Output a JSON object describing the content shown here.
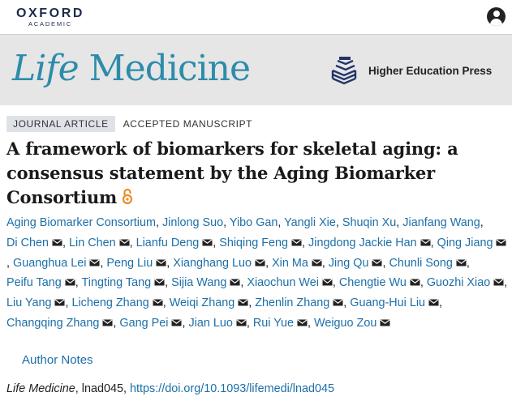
{
  "header": {
    "brand_main": "OXFORD",
    "brand_sub": "ACADEMIC"
  },
  "banner": {
    "journal_word1": "Life",
    "journal_word2": "Medicine",
    "publisher": "Higher Education Press",
    "journal_color": "#2e8cab"
  },
  "article": {
    "type_badge": "JOURNAL ARTICLE",
    "status": "ACCEPTED MANUSCRIPT",
    "title": "A framework of biomarkers for skeletal aging: a consensus statement by the Aging Biomarker Consortium",
    "open_access_icon": "open-access-icon",
    "authors": [
      {
        "name": "Aging Biomarker Consortium",
        "email": false
      },
      {
        "name": "Jinlong Suo",
        "email": false
      },
      {
        "name": "Yibo Gan",
        "email": false
      },
      {
        "name": "Yangli Xie",
        "email": false
      },
      {
        "name": "Shuqin Xu",
        "email": false
      },
      {
        "name": "Jianfang Wang",
        "email": false
      },
      {
        "name": "Di Chen",
        "email": true
      },
      {
        "name": "Lin Chen",
        "email": true
      },
      {
        "name": "Lianfu Deng",
        "email": true
      },
      {
        "name": "Shiqing Feng",
        "email": true
      },
      {
        "name": "Jingdong Jackie Han",
        "email": true
      },
      {
        "name": "Qing Jiang",
        "email": true
      },
      {
        "name": "Guanghua Lei",
        "email": true
      },
      {
        "name": "Peng Liu",
        "email": true
      },
      {
        "name": "Xianghang Luo",
        "email": true
      },
      {
        "name": "Xin Ma",
        "email": true
      },
      {
        "name": "Jing Qu",
        "email": true
      },
      {
        "name": "Chunli Song",
        "email": true
      },
      {
        "name": "Peifu Tang",
        "email": true
      },
      {
        "name": "Tingting Tang",
        "email": true
      },
      {
        "name": "Sijia Wang",
        "email": true
      },
      {
        "name": "Xiaochun Wei",
        "email": true
      },
      {
        "name": "Chengtie Wu",
        "email": true
      },
      {
        "name": "Guozhi Xiao",
        "email": true
      },
      {
        "name": "Liu Yang",
        "email": true
      },
      {
        "name": "Licheng Zhang",
        "email": true
      },
      {
        "name": "Weiqi Zhang",
        "email": true
      },
      {
        "name": "Zhenlin Zhang",
        "email": true
      },
      {
        "name": "Guang-Hui Liu",
        "email": true
      },
      {
        "name": "Changqing Zhang",
        "email": true
      },
      {
        "name": "Gang Pei",
        "email": true
      },
      {
        "name": "Jian Luo",
        "email": true
      },
      {
        "name": "Rui Yue",
        "email": true
      },
      {
        "name": "Weiguo Zou",
        "email": true
      }
    ],
    "author_notes_label": "Author Notes",
    "citation_journal": "Life Medicine",
    "citation_id": ", lnad045, ",
    "doi": "https://doi.org/10.1093/lifemedi/lnad045"
  },
  "colors": {
    "link": "#1d6fa8",
    "banner_bg": "#e6e6e6",
    "open_access": "#f08a24"
  }
}
